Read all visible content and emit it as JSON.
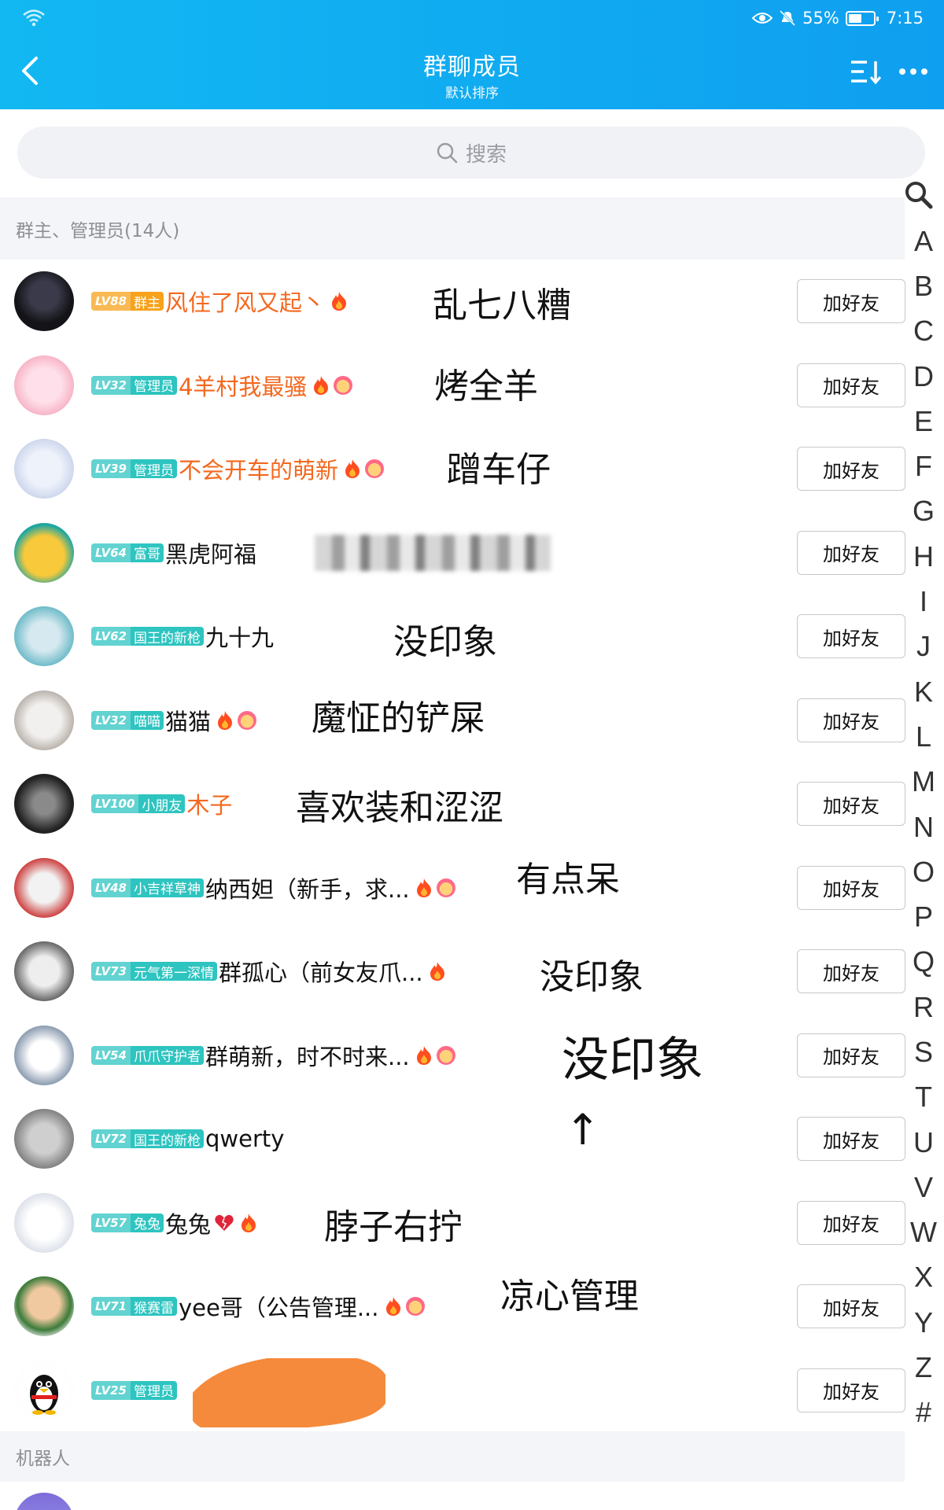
{
  "status_bar": {
    "battery": "55%",
    "battery_level": 0.55,
    "time": "7:15"
  },
  "header": {
    "title": "群聊成员",
    "subtitle": "默认排序"
  },
  "search": {
    "placeholder": "搜索"
  },
  "sections": {
    "admins": "群主、管理员(14人)",
    "robots": "机器人"
  },
  "add_friend_label": "加好友",
  "members": [
    {
      "level": "LV88",
      "role": "群主",
      "badge_color": "#f7a21b",
      "name": "风住了风又起丶",
      "name_color": "orange",
      "icons": [
        "flame"
      ],
      "annotation": "乱七八糟"
    },
    {
      "level": "LV32",
      "role": "管理员",
      "badge_color": "#2ec4c0",
      "name": "4羊村我最骚",
      "name_color": "orange",
      "icons": [
        "flame",
        "emoji"
      ],
      "annotation": "烤全羊"
    },
    {
      "level": "LV39",
      "role": "管理员",
      "badge_color": "#2ec4c0",
      "name": "不会开车的萌新",
      "name_color": "orange",
      "icons": [
        "flame",
        "emoji"
      ],
      "annotation": "蹭车仔"
    },
    {
      "level": "LV64",
      "role": "富哥",
      "badge_color": "#2ec4c0",
      "name": "黑虎阿福",
      "name_color": "black",
      "icons": [],
      "annotation": ""
    },
    {
      "level": "LV62",
      "role": "国王的新枪",
      "badge_color": "#2ec4c0",
      "name": "九十九",
      "name_color": "black",
      "icons": [],
      "annotation": "没印象"
    },
    {
      "level": "LV32",
      "role": "喵喵",
      "badge_color": "#2ec4c0",
      "name": "猫猫",
      "name_color": "black",
      "icons": [
        "flame",
        "emoji"
      ],
      "annotation": "魔怔的铲屎"
    },
    {
      "level": "LV100",
      "role": "小朋友",
      "badge_color": "#2ec4c0",
      "name": "木子",
      "name_color": "orange",
      "icons": [],
      "annotation": "喜欢装和涩涩"
    },
    {
      "level": "LV48",
      "role": "小吉祥草神",
      "badge_color": "#2ec4c0",
      "name": "纳西妲（新手，求...",
      "name_color": "black",
      "icons": [
        "flame",
        "emoji"
      ],
      "annotation": "有点呆"
    },
    {
      "level": "LV73",
      "role": "元气第一深情",
      "badge_color": "#2ec4c0",
      "name": "群孤心（前女友爪...",
      "name_color": "black",
      "icons": [
        "flame"
      ],
      "annotation": "没印象"
    },
    {
      "level": "LV54",
      "role": "爪爪守护者",
      "badge_color": "#2ec4c0",
      "name": "群萌新，时不时来...",
      "name_color": "black",
      "icons": [
        "flame",
        "emoji"
      ],
      "annotation": "没印象"
    },
    {
      "level": "LV72",
      "role": "国王的新枪",
      "badge_color": "#2ec4c0",
      "name": "qwerty",
      "name_color": "black",
      "icons": [],
      "annotation": "↑"
    },
    {
      "level": "LV57",
      "role": "兔兔",
      "badge_color": "#2ec4c0",
      "name": "兔兔",
      "name_color": "black",
      "icons": [
        "heart",
        "flame"
      ],
      "annotation": "脖子右拧"
    },
    {
      "level": "LV71",
      "role": "猴赛雷",
      "badge_color": "#2ec4c0",
      "name": "yee哥（公告管理...",
      "name_color": "black",
      "icons": [
        "flame",
        "emoji"
      ],
      "annotation": "凉心管理"
    },
    {
      "level": "LV25",
      "role": "管理员",
      "badge_color": "#2ec4c0",
      "name": "",
      "name_color": "black",
      "icons": [],
      "annotation": ""
    }
  ],
  "alphabet": [
    "A",
    "B",
    "C",
    "D",
    "E",
    "F",
    "G",
    "H",
    "I",
    "J",
    "K",
    "L",
    "M",
    "N",
    "O",
    "P",
    "Q",
    "R",
    "S",
    "T",
    "U",
    "V",
    "W",
    "X",
    "Y",
    "Z",
    "#"
  ]
}
